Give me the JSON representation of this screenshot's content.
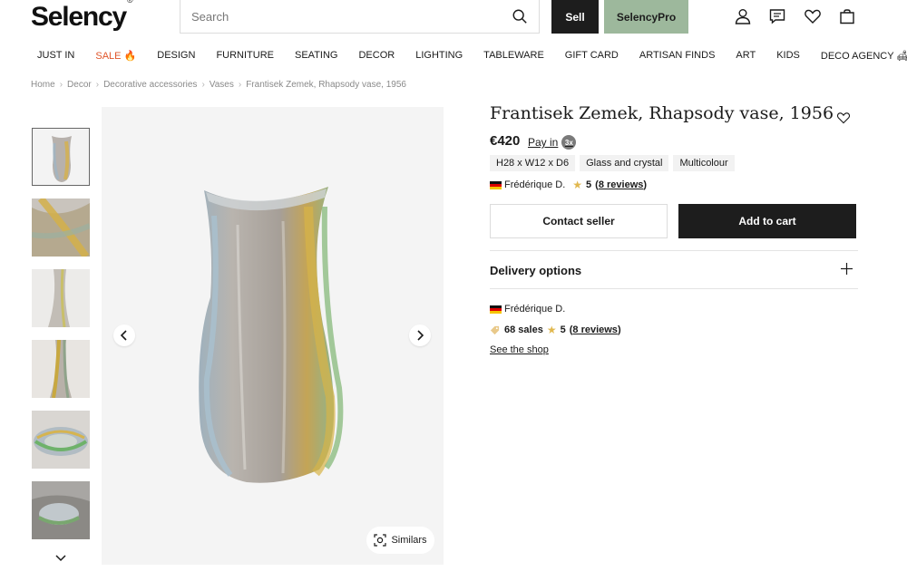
{
  "header": {
    "logo": "Selency",
    "logo_mark": "®",
    "search_placeholder": "Search",
    "sell_label": "Sell",
    "pro_label": "SelencyPro"
  },
  "nav": [
    {
      "label": "JUST IN"
    },
    {
      "label": "SALE 🔥"
    },
    {
      "label": "DESIGN"
    },
    {
      "label": "FURNITURE"
    },
    {
      "label": "SEATING"
    },
    {
      "label": "DECOR"
    },
    {
      "label": "LIGHTING"
    },
    {
      "label": "TABLEWARE"
    },
    {
      "label": "GIFT CARD"
    },
    {
      "label": "ARTISAN FINDS"
    },
    {
      "label": "ART"
    },
    {
      "label": "KIDS"
    },
    {
      "label": "DECO AGENCY 🛋"
    }
  ],
  "breadcrumb": [
    "Home",
    "Decor",
    "Decorative accessories",
    "Vases",
    "Frantisek Zemek, Rhapsody vase, 1956"
  ],
  "breadcrumb_sep": "›",
  "gallery": {
    "similars_label": "Similars"
  },
  "product": {
    "title": "Frantisek Zemek, Rhapsody vase, 1956",
    "price": "€420",
    "pay_in": "Pay in",
    "pay_badge": "3x",
    "tags": [
      "H28 x W12 x D6",
      "Glass and crystal",
      "Multicolour"
    ],
    "seller_name": "Frédérique D.",
    "rating": "5",
    "reviews": "8 reviews",
    "contact_label": "Contact seller",
    "cart_label": "Add to cart",
    "delivery_label": "Delivery options"
  },
  "seller": {
    "name": "Frédérique D.",
    "sales": "68 sales",
    "rating": "5",
    "reviews": "8 reviews",
    "shop_link": "See the shop"
  },
  "colors": {
    "dark": "#1d1d1d",
    "pro_green": "#9db89c",
    "sale_orange": "#e0552a",
    "star": "#e1b84f"
  }
}
